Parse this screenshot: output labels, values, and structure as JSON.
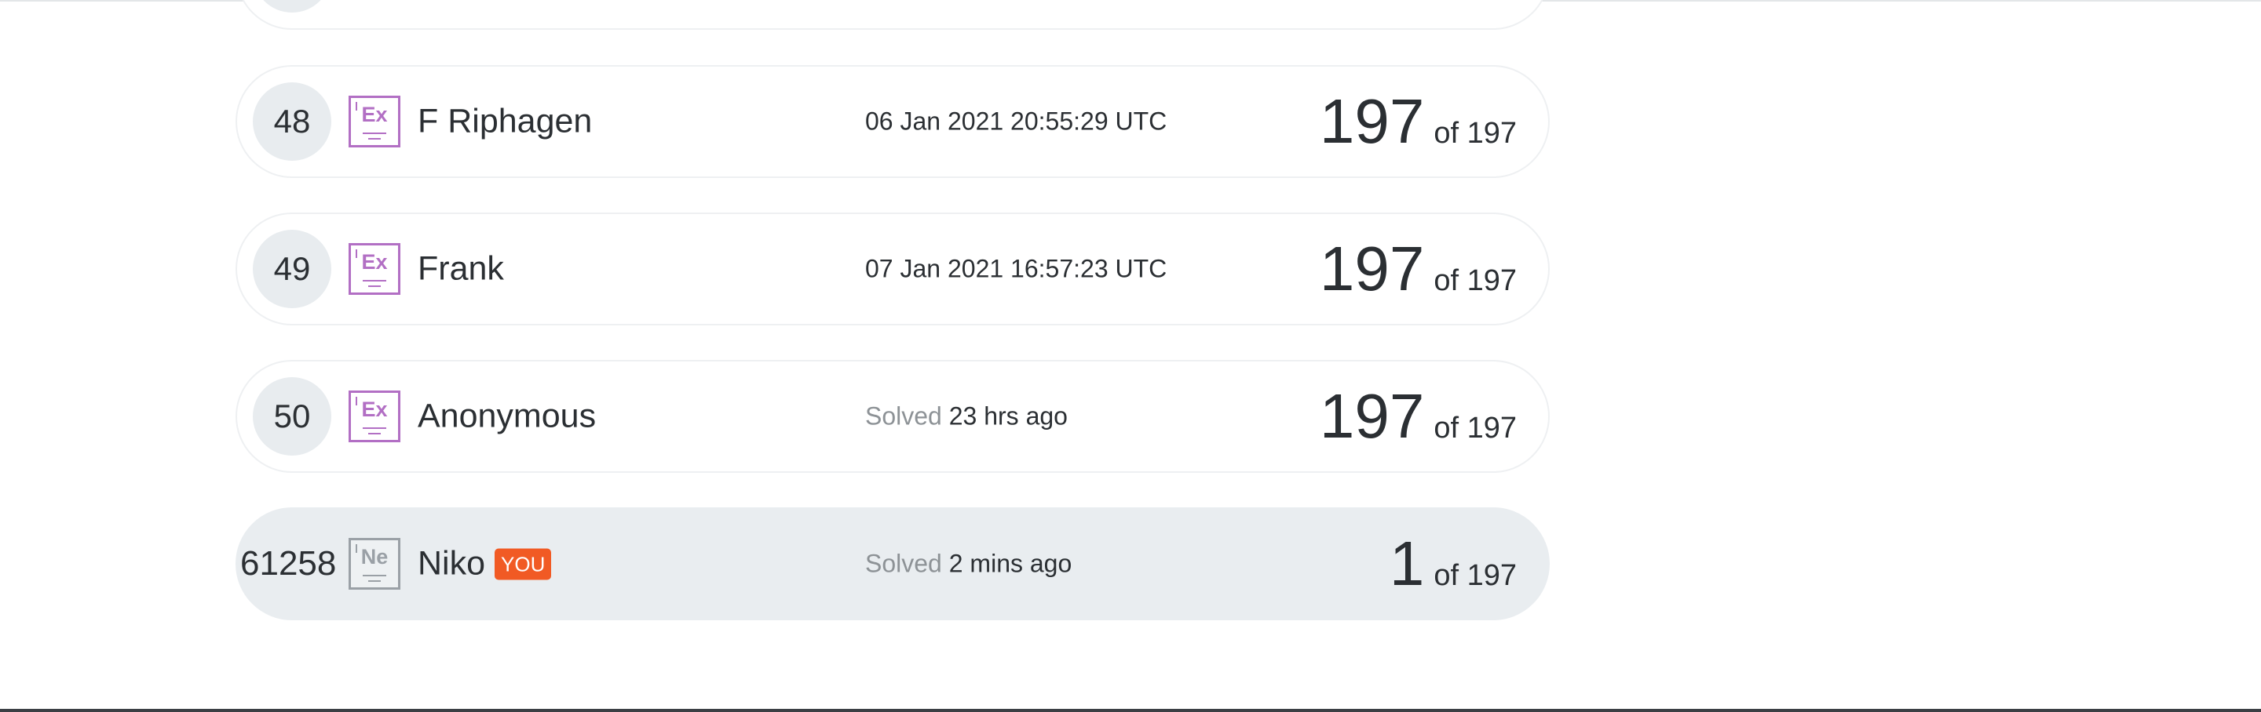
{
  "leaderboard": {
    "rows": [
      {
        "rank": "48",
        "element_symbol": "Ex",
        "element_icon": "expert-badge-icon",
        "name": "F Riphagen",
        "timestamp": "06 Jan 2021 20:55:29 UTC",
        "score": "197",
        "total": "of 197"
      },
      {
        "rank": "49",
        "element_symbol": "Ex",
        "element_icon": "expert-badge-icon",
        "name": "Frank",
        "timestamp": "07 Jan 2021 16:57:23 UTC",
        "score": "197",
        "total": "of 197"
      },
      {
        "rank": "50",
        "element_symbol": "Ex",
        "element_icon": "expert-badge-icon",
        "name": "Anonymous",
        "solved_prefix": "Solved",
        "solved_time": "23 hrs ago",
        "score": "197",
        "total": "of 197"
      }
    ],
    "current_user": {
      "rank": "61258",
      "element_symbol": "Ne",
      "element_icon": "newbie-badge-icon",
      "name": "Niko",
      "badge": "YOU",
      "solved_prefix": "Solved",
      "solved_time": "2 mins ago",
      "score": "1",
      "total": "of 197"
    }
  },
  "colors": {
    "expert_badge": "#b26fc4",
    "newbie_badge": "#9aa0a6",
    "you_badge": "#f15a24",
    "you_row_bg": "#e9edf0"
  }
}
